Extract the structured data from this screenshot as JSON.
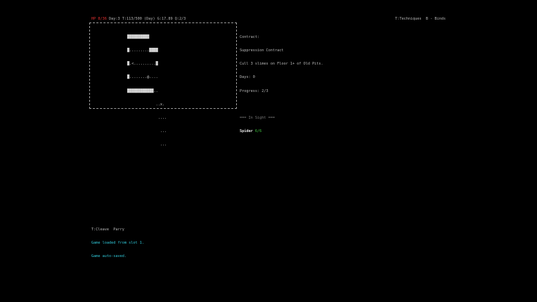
{
  "status": {
    "hp": "HP 8/36",
    "rest": " Day:3 T:113/500 (Day) G:17.89 Q:2/3"
  },
  "hints": "T:Techniques  B - Binds",
  "map": {
    "rows": [
      "██████████",
      "█.........████",
      "█.<..........█",
      "█........@....",
      "████████████..",
      "             ..x.",
      "              ....",
      "               ...",
      "               ..."
    ]
  },
  "contract": {
    "header": "Contract:",
    "title": "Suppression Contract",
    "goal": "Cull 3 slimes on Floor 1+ of Old Pits.",
    "days": "Days: 0",
    "progress": "Progress: 2/3"
  },
  "in_sight": {
    "header": "=== In Sight ===",
    "enemies": [
      {
        "name": "Spider",
        "hp": "6/6"
      }
    ]
  },
  "log": {
    "hint": "T:Cleave  Parry",
    "messages": [
      "Game loaded from slot 1.",
      "Game auto-saved."
    ]
  },
  "colors": {
    "background": "#000000",
    "hp": "#e03030",
    "log_message": "#30c8d8",
    "enemy_hp": "#40c040"
  }
}
